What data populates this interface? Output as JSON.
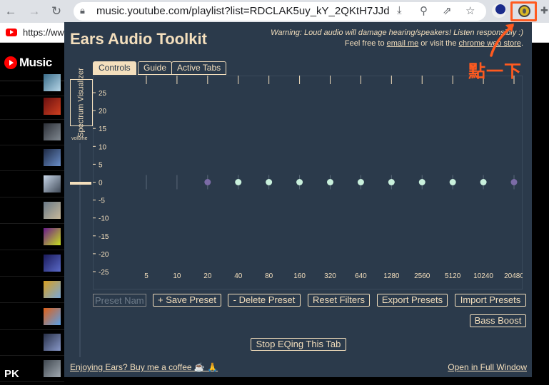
{
  "browser": {
    "url": "music.youtube.com/playlist?list=RDCLAK5uy_kY_2QKtH7JJd...",
    "tab_url": "https://ww",
    "colors": {
      "annotation": "#ff5a1f"
    }
  },
  "page": {
    "logo_text": "Music",
    "watermark": "PK"
  },
  "popup": {
    "title": "Ears Audio Toolkit",
    "warning": "Warning: Loud audio will damage hearing/speakers! Listen responsibly :)",
    "feedback_prefix": "Feel free to ",
    "email_link": "email me",
    "feedback_mid": " or visit the ",
    "store_link": "chrome web store",
    "feedback_suffix": ".",
    "tabs": [
      "Controls",
      "Guide",
      "Active Tabs"
    ],
    "spectrum_label": "Spectrum Visualizer",
    "volume_label": "volume",
    "preset_placeholder": "Preset Name",
    "buttons": {
      "save_preset": "+ Save Preset",
      "delete_preset": "- Delete Preset",
      "reset_filters": "Reset Filters",
      "export_presets": "Export Presets",
      "import_presets": "Import Presets",
      "bass_boost": "Bass Boost",
      "stop_eq": "Stop EQing This Tab"
    },
    "footer": {
      "coffee": "Enjoying Ears? Buy me a coffee ☕ 🙏",
      "full_window": "Open in Full Window"
    },
    "colors": {
      "background": "#2b3a4b",
      "accent": "#f4dfbd",
      "point": "#c9f0dc",
      "shelf_point": "#7b6ba6"
    }
  },
  "annotation": {
    "text": "點一下"
  },
  "chart_data": {
    "type": "scatter",
    "ylim": [
      -25,
      25
    ],
    "y_ticks": [
      25,
      20,
      15,
      10,
      5,
      0,
      -5,
      -10,
      -15,
      -20,
      -25
    ],
    "x_ticks": [
      5,
      10,
      20,
      40,
      80,
      160,
      320,
      640,
      1280,
      2560,
      5120,
      10240,
      20480
    ],
    "points": [
      {
        "freq": 20,
        "gain": 0,
        "kind": "shelf"
      },
      {
        "freq": 40,
        "gain": 0,
        "kind": "peak"
      },
      {
        "freq": 80,
        "gain": 0,
        "kind": "peak"
      },
      {
        "freq": 160,
        "gain": 0,
        "kind": "peak"
      },
      {
        "freq": 320,
        "gain": 0,
        "kind": "peak"
      },
      {
        "freq": 640,
        "gain": 0,
        "kind": "peak"
      },
      {
        "freq": 1280,
        "gain": 0,
        "kind": "peak"
      },
      {
        "freq": 2560,
        "gain": 0,
        "kind": "peak"
      },
      {
        "freq": 5120,
        "gain": 0,
        "kind": "peak"
      },
      {
        "freq": 10240,
        "gain": 0,
        "kind": "peak"
      },
      {
        "freq": 20480,
        "gain": 0,
        "kind": "shelf"
      }
    ]
  }
}
